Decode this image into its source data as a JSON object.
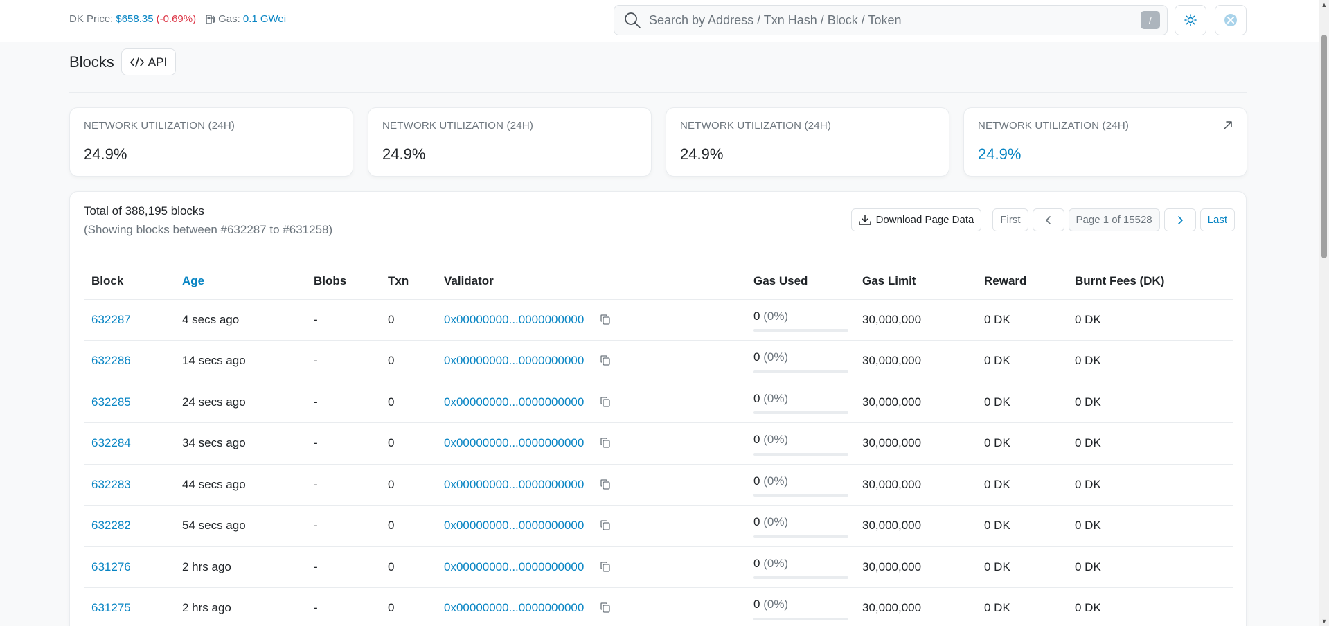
{
  "header": {
    "price_label": "DK Price:",
    "price_value": "$658.35",
    "price_change": "(-0.69%)",
    "gas_label": "Gas:",
    "gas_value": "0.1 GWei",
    "search_placeholder": "Search by Address / Txn Hash / Block / Token",
    "search_shortcut": "/"
  },
  "page": {
    "title": "Blocks",
    "api_label": "API"
  },
  "stats": [
    {
      "label": "NETWORK UTILIZATION (24H)",
      "value": "24.9%"
    },
    {
      "label": "NETWORK UTILIZATION (24H)",
      "value": "24.9%"
    },
    {
      "label": "NETWORK UTILIZATION (24H)",
      "value": "24.9%"
    },
    {
      "label": "NETWORK UTILIZATION (24H)",
      "value": "24.9%"
    }
  ],
  "table_summary": {
    "total": "Total of 388,195 blocks",
    "showing": "(Showing blocks between #632287 to #631258)"
  },
  "pager": {
    "download": "Download Page Data",
    "first": "First",
    "page_info": "Page 1 of 15528",
    "last": "Last"
  },
  "columns": {
    "block": "Block",
    "age": "Age",
    "blobs": "Blobs",
    "txn": "Txn",
    "validator": "Validator",
    "gas_used": "Gas Used",
    "gas_limit": "Gas Limit",
    "reward": "Reward",
    "burnt_fees": "Burnt Fees (DK)"
  },
  "rows": [
    {
      "block": "632287",
      "age": "4 secs ago",
      "blobs": "-",
      "txn": "0",
      "validator": "0x00000000...0000000000",
      "gas_used": "0",
      "gas_pct": "(0%)",
      "gas_fill": 0,
      "gas_limit": "30,000,000",
      "reward": "0 DK",
      "burnt": "0 DK"
    },
    {
      "block": "632286",
      "age": "14 secs ago",
      "blobs": "-",
      "txn": "0",
      "validator": "0x00000000...0000000000",
      "gas_used": "0",
      "gas_pct": "(0%)",
      "gas_fill": 0,
      "gas_limit": "30,000,000",
      "reward": "0 DK",
      "burnt": "0 DK"
    },
    {
      "block": "632285",
      "age": "24 secs ago",
      "blobs": "-",
      "txn": "0",
      "validator": "0x00000000...0000000000",
      "gas_used": "0",
      "gas_pct": "(0%)",
      "gas_fill": 0,
      "gas_limit": "30,000,000",
      "reward": "0 DK",
      "burnt": "0 DK"
    },
    {
      "block": "632284",
      "age": "34 secs ago",
      "blobs": "-",
      "txn": "0",
      "validator": "0x00000000...0000000000",
      "gas_used": "0",
      "gas_pct": "(0%)",
      "gas_fill": 0,
      "gas_limit": "30,000,000",
      "reward": "0 DK",
      "burnt": "0 DK"
    },
    {
      "block": "632283",
      "age": "44 secs ago",
      "blobs": "-",
      "txn": "0",
      "validator": "0x00000000...0000000000",
      "gas_used": "0",
      "gas_pct": "(0%)",
      "gas_fill": 0,
      "gas_limit": "30,000,000",
      "reward": "0 DK",
      "burnt": "0 DK"
    },
    {
      "block": "632282",
      "age": "54 secs ago",
      "blobs": "-",
      "txn": "0",
      "validator": "0x00000000...0000000000",
      "gas_used": "0",
      "gas_pct": "(0%)",
      "gas_fill": 0,
      "gas_limit": "30,000,000",
      "reward": "0 DK",
      "burnt": "0 DK"
    },
    {
      "block": "631276",
      "age": "2 hrs ago",
      "blobs": "-",
      "txn": "0",
      "validator": "0x00000000...0000000000",
      "gas_used": "0",
      "gas_pct": "(0%)",
      "gas_fill": 0,
      "gas_limit": "30,000,000",
      "reward": "0 DK",
      "burnt": "0 DK"
    },
    {
      "block": "631275",
      "age": "2 hrs ago",
      "blobs": "-",
      "txn": "0",
      "validator": "0x00000000...0000000000",
      "gas_used": "0",
      "gas_pct": "(0%)",
      "gas_fill": 0,
      "gas_limit": "30,000,000",
      "reward": "0 DK",
      "burnt": "0 DK"
    }
  ]
}
